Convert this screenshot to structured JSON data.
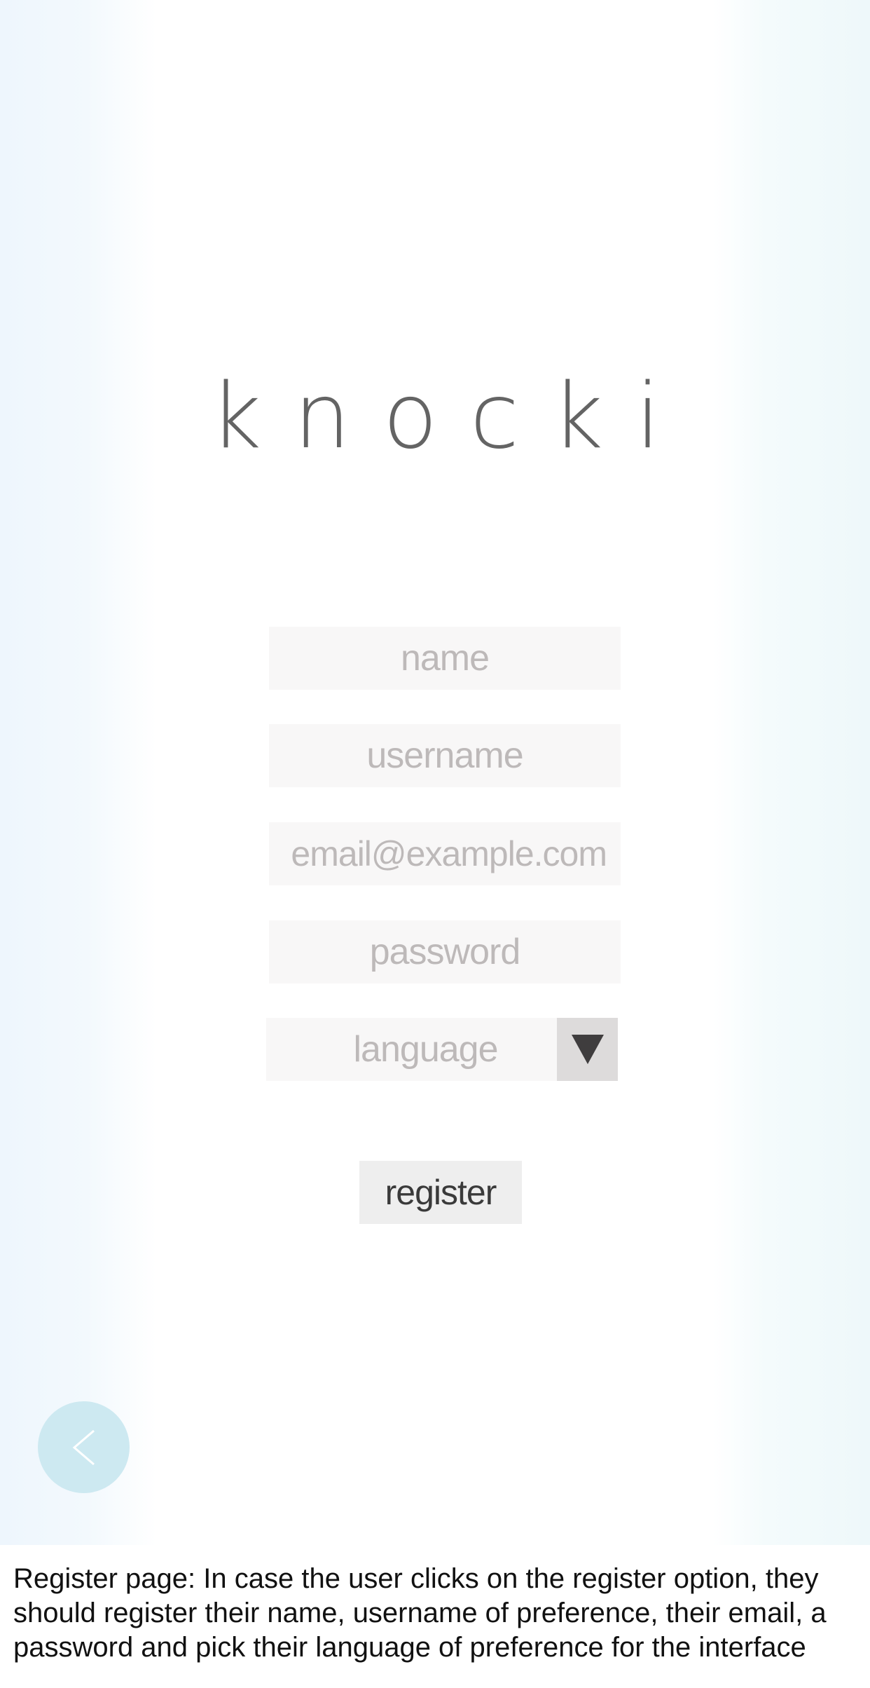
{
  "app": {
    "logo_text": "knocki"
  },
  "form": {
    "name_placeholder": "name",
    "username_placeholder": "username",
    "email_placeholder": "email@example.com",
    "password_placeholder": "password",
    "language_select": {
      "selected": "language",
      "toggle_icon": "triangle-down-icon"
    },
    "register_label": "register"
  },
  "navigation": {
    "back_icon": "chevron-left-icon"
  },
  "caption": {
    "text": "Register page: In case the user clicks on the register option, they should register their name, username of preference, their email, a password and pick their language of preference for the interface"
  },
  "colors": {
    "field_background": "#f8f7f7",
    "select_button_background": "#dddbdb",
    "register_button_background": "#eeeeee",
    "back_button_background": "#cde9f1",
    "logo_color": "#4a4a4a",
    "placeholder_color": "#bdb9b9"
  }
}
